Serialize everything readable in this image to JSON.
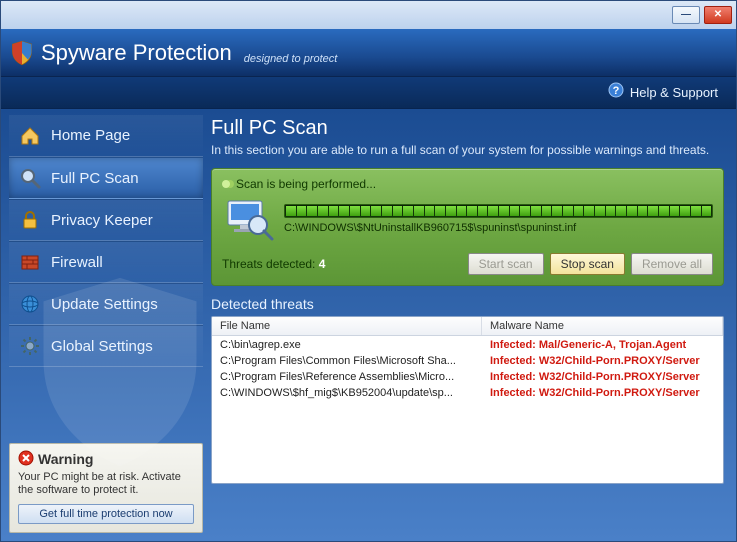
{
  "app": {
    "title": "Spyware Protection",
    "subtitle": "designed to protect"
  },
  "help": {
    "label": "Help & Support"
  },
  "sidebar": {
    "items": [
      {
        "label": "Home Page"
      },
      {
        "label": "Full PC Scan"
      },
      {
        "label": "Privacy Keeper"
      },
      {
        "label": "Firewall"
      },
      {
        "label": "Update Settings"
      },
      {
        "label": "Global Settings"
      }
    ]
  },
  "warning": {
    "title": "Warning",
    "body": "Your PC might be at risk.\nActivate the software to protect it.",
    "button": "Get full time protection now"
  },
  "main": {
    "heading": "Full PC Scan",
    "description": "In this section you are able to run a full scan of your system for possible warnings and threats.",
    "scan": {
      "status": "Scan is being performed...",
      "path": "C:\\WINDOWS\\$NtUninstallKB960715$\\spuninst\\spuninst.inf",
      "threats_label": "Threats detected:",
      "threats_count": "4",
      "buttons": {
        "start": "Start scan",
        "stop": "Stop scan",
        "remove": "Remove all"
      }
    },
    "detected_heading": "Detected threats",
    "table": {
      "col1": "File Name",
      "col2": "Malware Name",
      "rows": [
        {
          "file": "C:\\bin\\agrep.exe",
          "mal": "Infected: Mal/Generic-A, Trojan.Agent"
        },
        {
          "file": "C:\\Program Files\\Common Files\\Microsoft Sha...",
          "mal": "Infected: W32/Child-Porn.PROXY/Server"
        },
        {
          "file": "C:\\Program Files\\Reference Assemblies\\Micro...",
          "mal": "Infected: W32/Child-Porn.PROXY/Server"
        },
        {
          "file": "C:\\WINDOWS\\$hf_mig$\\KB952004\\update\\sp...",
          "mal": "Infected: W32/Child-Porn.PROXY/Server"
        }
      ]
    }
  }
}
